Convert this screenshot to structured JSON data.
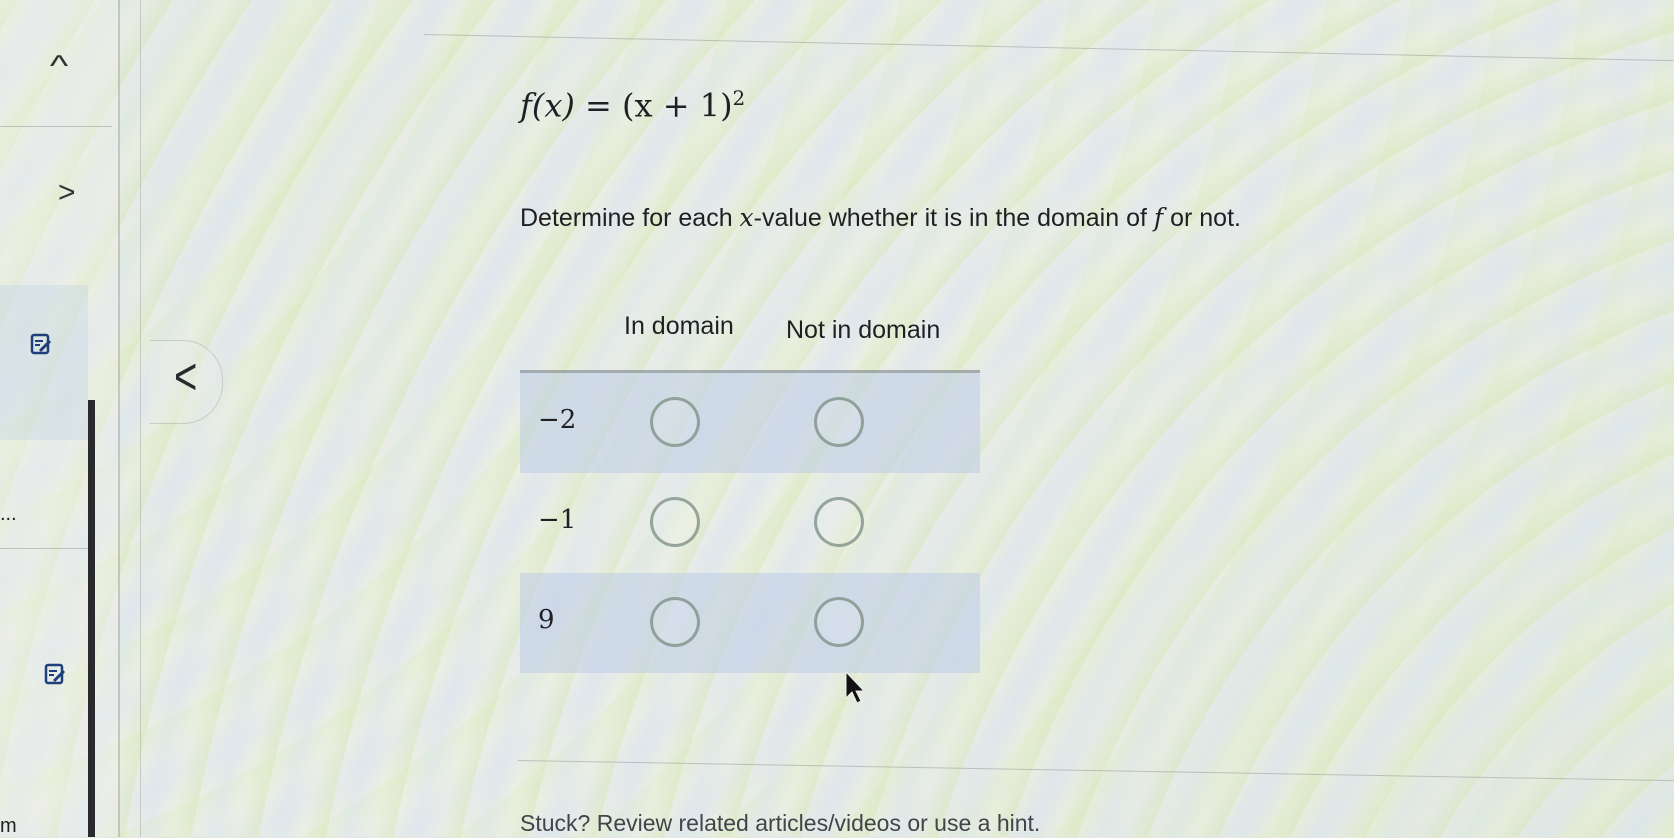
{
  "sidebar": {
    "up_chevron": "^",
    "right_chevron": ">",
    "ellipsis": "...",
    "trailing_letter": "m",
    "icons": [
      "edit-note-icon",
      "edit-note-icon"
    ]
  },
  "collapse": {
    "chevron": "<"
  },
  "question": {
    "formula_lhs": "f(x)",
    "formula_equals": " = ",
    "formula_rhs": "(x + 1)",
    "formula_exponent": "2",
    "instruction_before": "Determine for each ",
    "instruction_var": "x",
    "instruction_mid": "-value whether it is in the domain of ",
    "instruction_fn": "f",
    "instruction_after": " or not."
  },
  "table": {
    "columns": [
      "In domain",
      "Not in domain"
    ],
    "rows": [
      {
        "x": "−2"
      },
      {
        "x": "−1"
      },
      {
        "x": "9"
      }
    ]
  },
  "footer": {
    "text": "Stuck? Review related articles/videos or use a hint."
  },
  "colors": {
    "radio_border": "#7a8c82",
    "row_shade": "#becce6",
    "text": "#1f1f24"
  }
}
